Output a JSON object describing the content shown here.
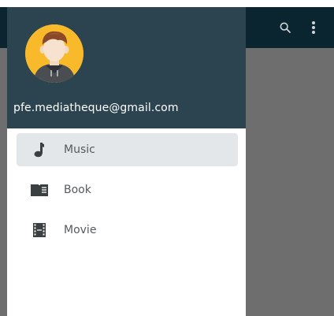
{
  "account": {
    "email": "pfe.mediatheque@gmail.com"
  },
  "menu": {
    "items": [
      {
        "label": "Music",
        "icon": "music-note-icon",
        "active": true
      },
      {
        "label": "Book",
        "icon": "book-icon",
        "active": false
      },
      {
        "label": "Movie",
        "icon": "film-icon",
        "active": false
      }
    ]
  },
  "appbar": {
    "actions": [
      "search-icon",
      "more-vert-icon"
    ]
  },
  "colors": {
    "header": "#2c4450",
    "appbar": "#0b2530",
    "active_item_bg": "#e4e7e9",
    "icon": "#3a3f42",
    "avatar_bg": "#f8b92a"
  }
}
